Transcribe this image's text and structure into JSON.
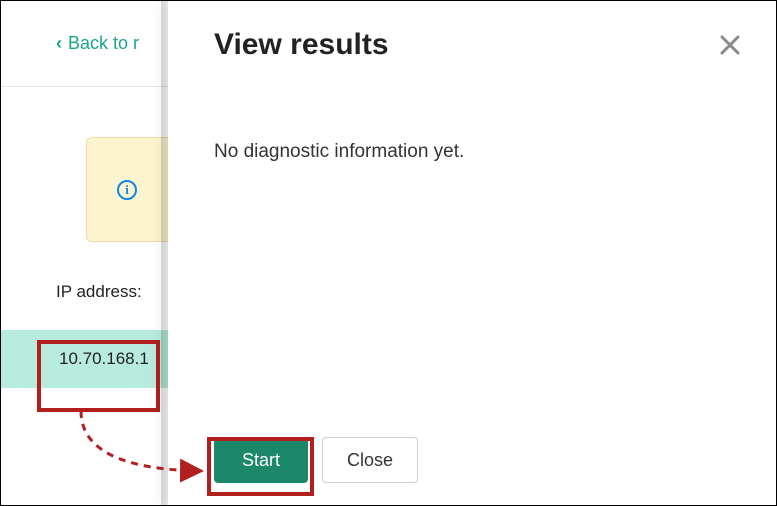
{
  "header": {
    "back_label": "Back to r"
  },
  "info_panel": {},
  "ip": {
    "label": "IP address:",
    "value": "10.70.168.1"
  },
  "modal": {
    "title": "View results",
    "message": "No diagnostic information yet.",
    "start_label": "Start",
    "close_label": "Close"
  }
}
